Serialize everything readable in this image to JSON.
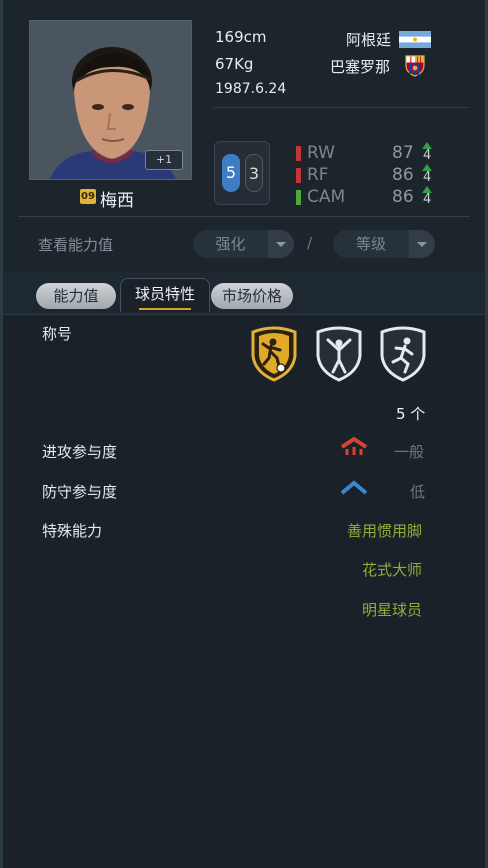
{
  "player": {
    "name": "梅西",
    "number": "09",
    "plus": "+1",
    "height": "169cm",
    "weight": "67Kg",
    "birthday": "1987.6.24",
    "nationality": "阿根廷",
    "club": "巴塞罗那",
    "nationality_flag_icon": "argentina-flag-icon",
    "club_crest_icon": "barcelona-crest-icon"
  },
  "feet": {
    "left": "5",
    "right": "3"
  },
  "positions": [
    {
      "name": "RW",
      "value": "87",
      "boost": "4",
      "color": "#c8333a"
    },
    {
      "name": "RF",
      "value": "86",
      "boost": "4",
      "color": "#c8333a"
    },
    {
      "name": "CAM",
      "value": "86",
      "boost": "4",
      "color": "#4ea93c"
    }
  ],
  "ability_view": {
    "label": "查看能力值",
    "enhance": "强化",
    "separator": "/",
    "level": "等级"
  },
  "tabs": [
    {
      "label": "能力值",
      "active": false
    },
    {
      "label": "球员特性",
      "active": true
    },
    {
      "label": "市场价格",
      "active": false
    }
  ],
  "traits": {
    "title_label": "称号",
    "title_icons": [
      "gold-trophy-player-icon",
      "celebration-player-icon",
      "running-player-icon"
    ],
    "count": "5 个",
    "attack_label": "进攻参与度",
    "attack_value": "一般",
    "defense_label": "防守参与度",
    "defense_value": "低",
    "special_label": "特殊能力",
    "special_skills": [
      "善用惯用脚",
      "花式大师",
      "明星球员"
    ]
  },
  "colors": {
    "accent_gold": "#d7a12b",
    "skill_green": "#8fb038",
    "attack_red": "#d8432e",
    "defense_blue": "#3d86d6"
  }
}
